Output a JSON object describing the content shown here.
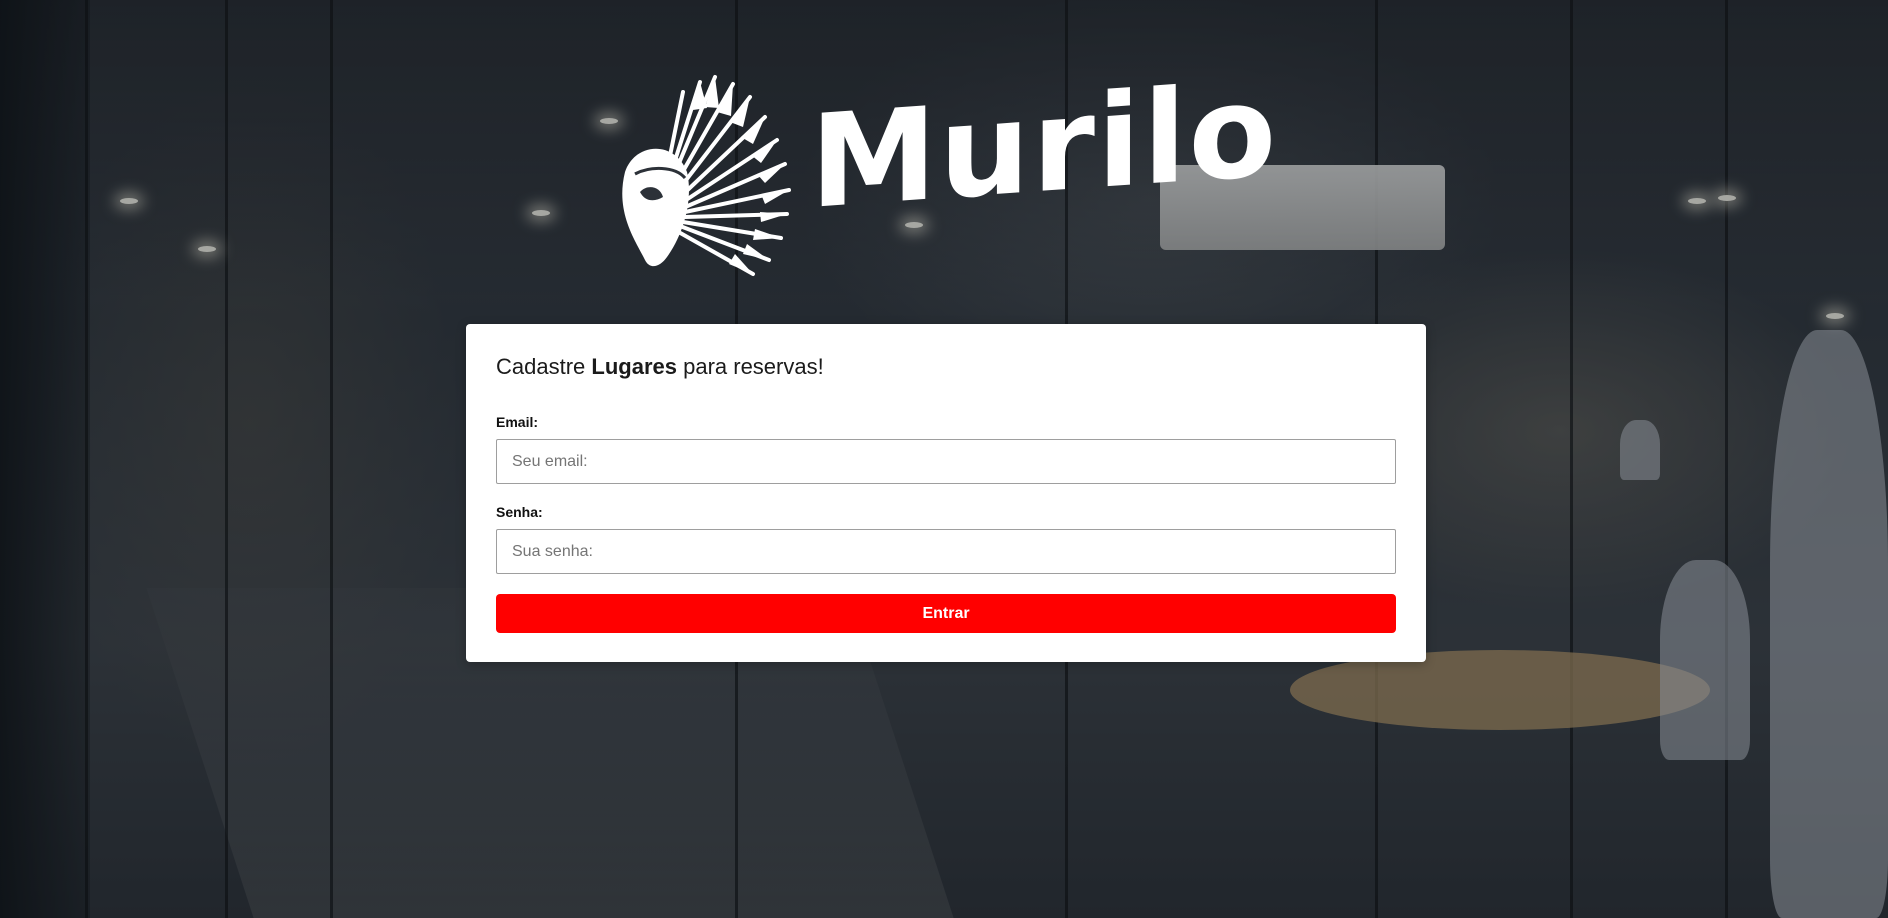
{
  "brand": {
    "logo_icon": "feather-headdress-icon",
    "name": "Murilo"
  },
  "form": {
    "title_prefix": "Cadastre ",
    "title_bold": "Lugares",
    "title_suffix": " para reservas!",
    "email": {
      "label": "Email:",
      "placeholder": "Seu email:",
      "value": ""
    },
    "password": {
      "label": "Senha:",
      "placeholder": "Sua senha:",
      "value": ""
    },
    "submit_label": "Entrar"
  },
  "colors": {
    "accent": "#ff0000",
    "card_background": "#ffffff",
    "logo": "#ffffff"
  }
}
